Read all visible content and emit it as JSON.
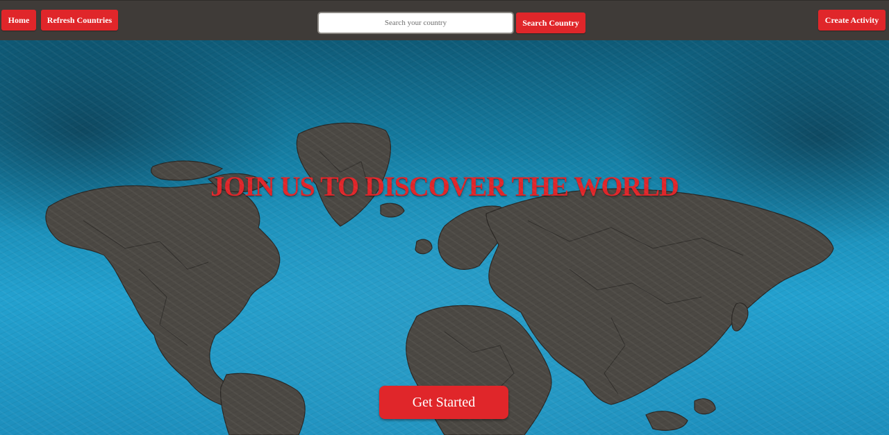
{
  "navbar": {
    "home_label": "Home",
    "refresh_label": "Refresh Countries",
    "search_placeholder": "Search your country",
    "search_button_label": "Search Country",
    "create_label": "Create Activity"
  },
  "hero": {
    "headline": "JOIN US TO DISCOVER THE WORLD",
    "cta_label": "Get Started",
    "background_image": "world-map-icon"
  },
  "colors": {
    "accent": "#e0262a",
    "navbar": "#3f3b38",
    "ocean": "#1786ad",
    "land": "#4b4843"
  }
}
